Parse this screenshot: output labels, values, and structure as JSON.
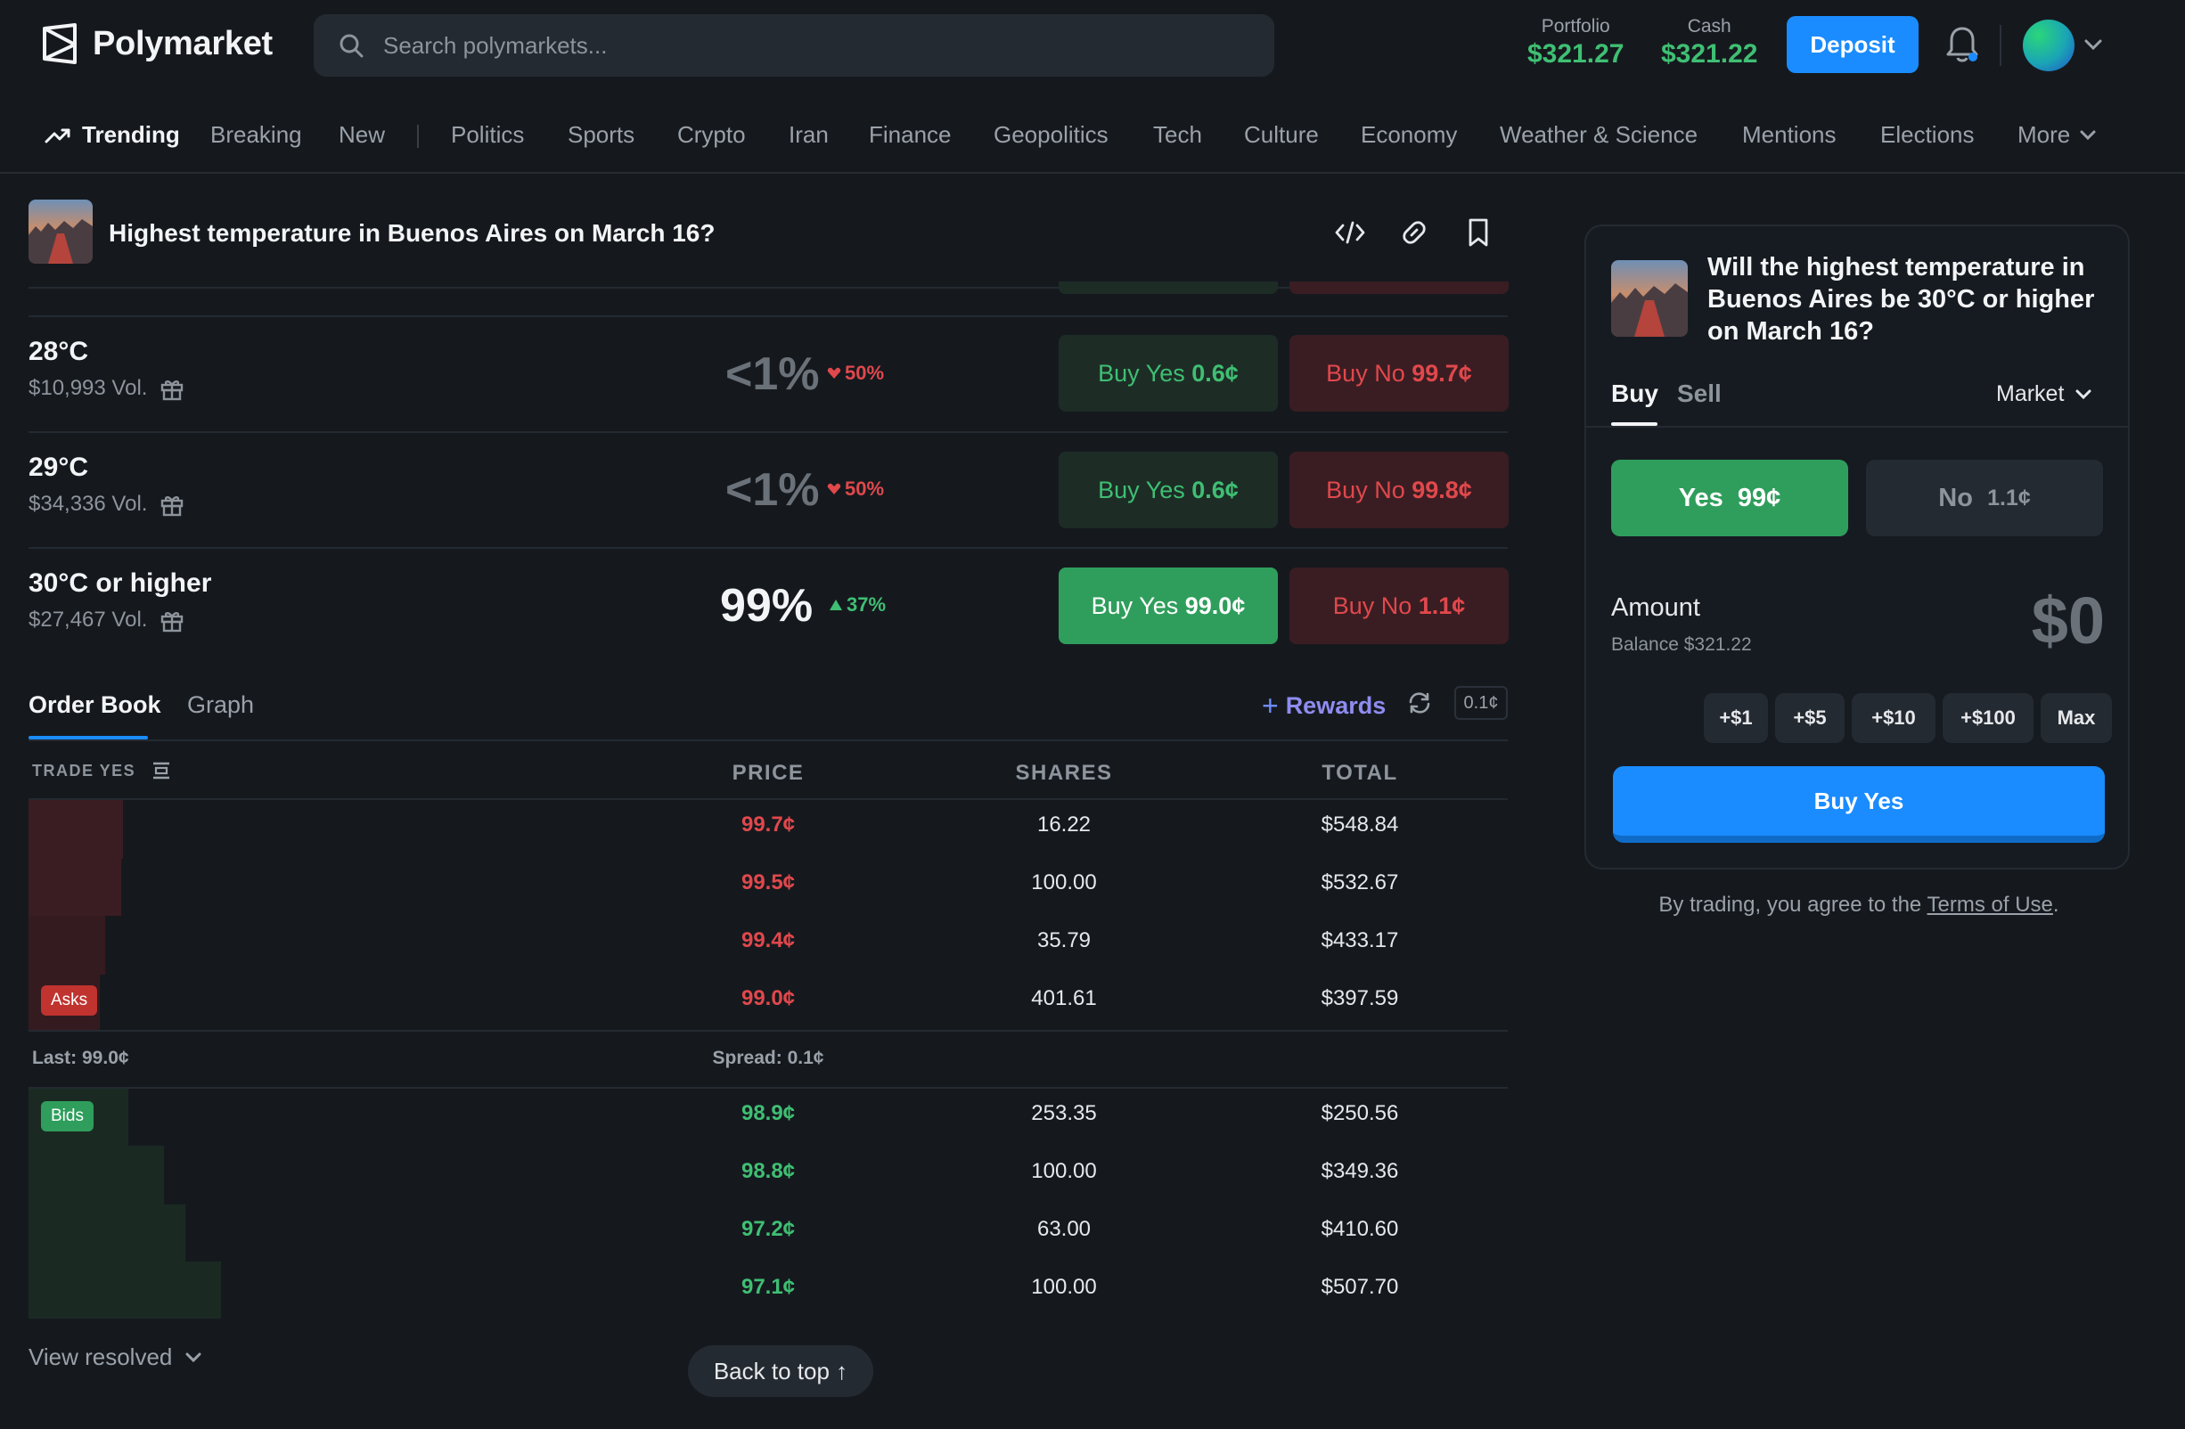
{
  "header": {
    "brand": "Polymarket",
    "search_placeholder": "Search polymarkets...",
    "portfolio_label": "Portfolio",
    "portfolio_value": "$321.27",
    "cash_label": "Cash",
    "cash_value": "$321.22",
    "deposit_label": "Deposit"
  },
  "nav": {
    "items": [
      "Trending",
      "Breaking",
      "New",
      "Politics",
      "Sports",
      "Crypto",
      "Iran",
      "Finance",
      "Geopolitics",
      "Tech",
      "Culture",
      "Economy",
      "Weather & Science",
      "Mentions",
      "Elections",
      "More"
    ]
  },
  "market": {
    "title": "Highest temperature in Buenos Aires on March 16?"
  },
  "outcomes": [
    {
      "name": "28°C",
      "volume": "$10,993 Vol.",
      "pct": "<1%",
      "change": "50%",
      "yes_label": "Buy Yes",
      "yes_price": "0.6¢",
      "no_label": "Buy No",
      "no_price": "99.7¢"
    },
    {
      "name": "29°C",
      "volume": "$34,336 Vol.",
      "pct": "<1%",
      "change": "50%",
      "yes_label": "Buy Yes",
      "yes_price": "0.6¢",
      "no_label": "Buy No",
      "no_price": "99.8¢"
    },
    {
      "name": "30°C or higher",
      "volume": "$27,467 Vol.",
      "pct": "99%",
      "change": "37%",
      "yes_label": "Buy Yes",
      "yes_price": "99.0¢",
      "no_label": "Buy No",
      "no_price": "1.1¢"
    }
  ],
  "tabs": {
    "order_book": "Order Book",
    "graph": "Graph",
    "rewards": "Rewards",
    "tick": "0.1¢"
  },
  "orderbook": {
    "headers": {
      "trade": "TRADE YES",
      "price": "PRICE",
      "shares": "SHARES",
      "total": "TOTAL"
    },
    "asks": [
      {
        "price": "99.7¢",
        "shares": "16.22",
        "total": "$548.84"
      },
      {
        "price": "99.5¢",
        "shares": "100.00",
        "total": "$532.67"
      },
      {
        "price": "99.4¢",
        "shares": "35.79",
        "total": "$433.17"
      },
      {
        "price": "99.0¢",
        "shares": "401.61",
        "total": "$397.59"
      }
    ],
    "asks_badge": "Asks",
    "last": "Last: 99.0¢",
    "spread": "Spread: 0.1¢",
    "bids_badge": "Bids",
    "bids": [
      {
        "price": "98.9¢",
        "shares": "253.35",
        "total": "$250.56"
      },
      {
        "price": "98.8¢",
        "shares": "100.00",
        "total": "$349.36"
      },
      {
        "price": "97.2¢",
        "shares": "63.00",
        "total": "$410.60"
      },
      {
        "price": "97.1¢",
        "shares": "100.00",
        "total": "$507.70"
      }
    ]
  },
  "footer": {
    "view_resolved": "View resolved",
    "back_to_top": "Back to top ↑"
  },
  "panel": {
    "title": "Will the highest temperature in Buenos Aires be 30°C or higher on March 16?",
    "buy_tab": "Buy",
    "sell_tab": "Sell",
    "order_type": "Market",
    "yes_label": "Yes",
    "yes_price": "99¢",
    "no_label": "No",
    "no_price": "1.1¢",
    "amount_label": "Amount",
    "balance": "Balance $321.22",
    "amount_value": "$0",
    "chips": [
      "+$1",
      "+$5",
      "+$10",
      "+$100",
      "Max"
    ],
    "buy_button": "Buy Yes",
    "terms_prefix": "By trading, you agree to the ",
    "terms_link": "Terms of Use",
    "terms_suffix": "."
  }
}
